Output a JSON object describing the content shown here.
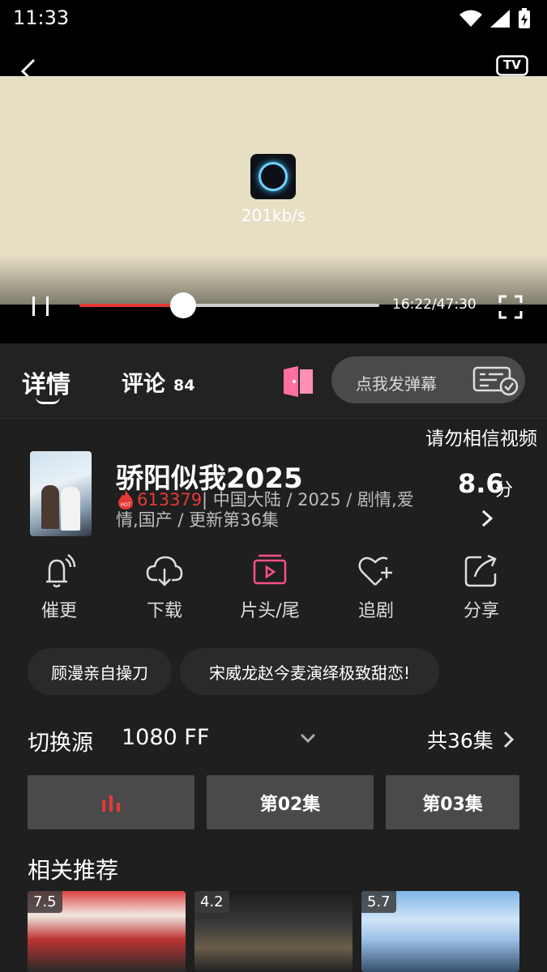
{
  "status_bar": {
    "time": "11:33",
    "icons": [
      "wifi-icon",
      "cell-signal-icon",
      "battery-charging-icon"
    ]
  },
  "player": {
    "back_icon": "chevron-left-icon",
    "tv_label": "TV",
    "speed": "201kb/s",
    "timecode": "16:22/47:30",
    "progress_fraction": 0.345,
    "pause_icon": "pause-icon",
    "fullscreen_icon": "fullscreen-icon"
  },
  "tabs": {
    "detail": "详情",
    "comments": "评论",
    "comments_count": "84"
  },
  "danmaku": {
    "placeholder": "点我发弹幕"
  },
  "notice": "请勿相信视频",
  "show": {
    "title": "骄阳似我2025",
    "hot_badge": "HOT",
    "hot_count": "613379",
    "meta": "|  中国大陆 / 2025 / 剧情,爱情,国产 / 更新第36集",
    "rating": "8.6",
    "rating_unit": "分"
  },
  "actions": [
    {
      "label": "催更",
      "icon": "bell-wifi-icon",
      "accent": false
    },
    {
      "label": "下载",
      "icon": "cloud-download-icon",
      "accent": false
    },
    {
      "label": "片头/尾",
      "icon": "tv-skip-icon",
      "accent": true
    },
    {
      "label": "追剧",
      "icon": "heart-plus-icon",
      "accent": false
    },
    {
      "label": "分享",
      "icon": "share-icon",
      "accent": false
    }
  ],
  "chips": [
    "顾漫亲自操刀",
    "宋威龙赵今麦演绎极致甜恋!"
  ],
  "source": {
    "label": "切换源",
    "value": "1080 FF",
    "episodes_total": "共36集"
  },
  "episodes": [
    "",
    "第02集",
    "第03集"
  ],
  "related": {
    "title": "相关推荐",
    "items": [
      {
        "score": "7.5"
      },
      {
        "score": "4.2"
      },
      {
        "score": "5.7"
      }
    ]
  },
  "colors": {
    "accent_red": "#e53935",
    "accent_pink": "#ff4f8b",
    "background": "#1f1f1f",
    "player_bg": "#e6dfc4"
  }
}
